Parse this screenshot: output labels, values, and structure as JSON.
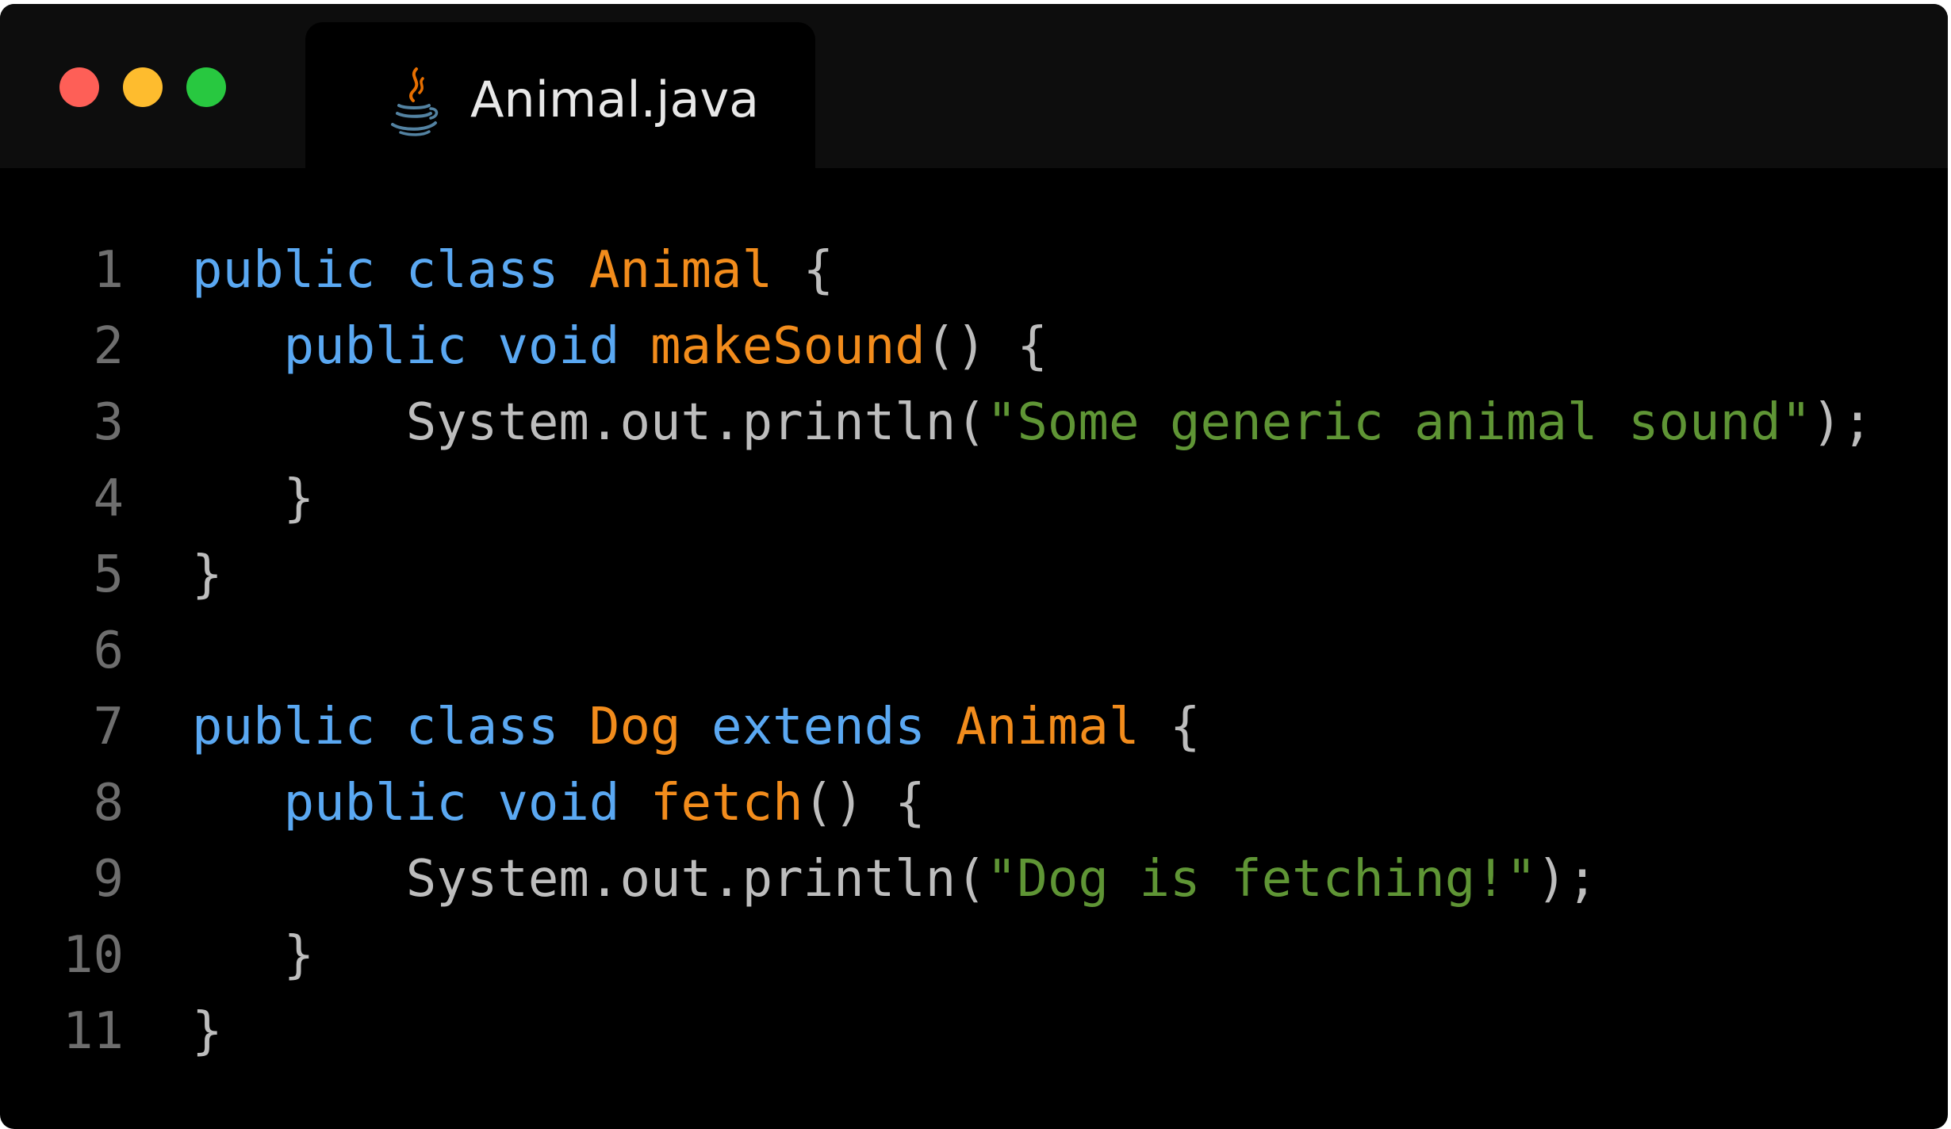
{
  "window": {
    "traffic_lights": [
      "close",
      "minimize",
      "zoom"
    ],
    "colors": {
      "close": "#fe5f57",
      "minimize": "#febc2e",
      "zoom": "#28c840",
      "keyword": "#5aa8f2",
      "type": "#f28c1c",
      "string": "#5f9535",
      "plain": "#bdbdbd",
      "line_number": "#6e6e6e"
    }
  },
  "tab": {
    "icon": "java-icon",
    "title": "Animal.java"
  },
  "code": {
    "language": "java",
    "lines": [
      {
        "number": "1",
        "tokens": [
          {
            "t": "keyword",
            "v": "public"
          },
          {
            "t": "plain",
            "v": " "
          },
          {
            "t": "keyword",
            "v": "class"
          },
          {
            "t": "plain",
            "v": " "
          },
          {
            "t": "type",
            "v": "Animal"
          },
          {
            "t": "plain",
            "v": " {"
          }
        ]
      },
      {
        "number": "2",
        "tokens": [
          {
            "t": "plain",
            "v": "   "
          },
          {
            "t": "keyword",
            "v": "public"
          },
          {
            "t": "plain",
            "v": " "
          },
          {
            "t": "keyword",
            "v": "void"
          },
          {
            "t": "plain",
            "v": " "
          },
          {
            "t": "method",
            "v": "makeSound"
          },
          {
            "t": "plain",
            "v": "() {"
          }
        ]
      },
      {
        "number": "3",
        "tokens": [
          {
            "t": "plain",
            "v": "       System.out.println("
          },
          {
            "t": "string",
            "v": "\"Some generic animal sound\""
          },
          {
            "t": "plain",
            "v": ");"
          }
        ]
      },
      {
        "number": "4",
        "tokens": [
          {
            "t": "plain",
            "v": "   }"
          }
        ]
      },
      {
        "number": "5",
        "tokens": [
          {
            "t": "plain",
            "v": "}"
          }
        ]
      },
      {
        "number": "6",
        "tokens": []
      },
      {
        "number": "7",
        "tokens": [
          {
            "t": "keyword",
            "v": "public"
          },
          {
            "t": "plain",
            "v": " "
          },
          {
            "t": "keyword",
            "v": "class"
          },
          {
            "t": "plain",
            "v": " "
          },
          {
            "t": "type",
            "v": "Dog"
          },
          {
            "t": "plain",
            "v": " "
          },
          {
            "t": "keyword",
            "v": "extends"
          },
          {
            "t": "plain",
            "v": " "
          },
          {
            "t": "type",
            "v": "Animal"
          },
          {
            "t": "plain",
            "v": " {"
          }
        ]
      },
      {
        "number": "8",
        "tokens": [
          {
            "t": "plain",
            "v": "   "
          },
          {
            "t": "keyword",
            "v": "public"
          },
          {
            "t": "plain",
            "v": " "
          },
          {
            "t": "keyword",
            "v": "void"
          },
          {
            "t": "plain",
            "v": " "
          },
          {
            "t": "method",
            "v": "fetch"
          },
          {
            "t": "plain",
            "v": "() {"
          }
        ]
      },
      {
        "number": "9",
        "tokens": [
          {
            "t": "plain",
            "v": "       System.out.println("
          },
          {
            "t": "string",
            "v": "\"Dog is fetching!\""
          },
          {
            "t": "plain",
            "v": ");"
          }
        ]
      },
      {
        "number": "10",
        "tokens": [
          {
            "t": "plain",
            "v": "   }"
          }
        ]
      },
      {
        "number": "11",
        "tokens": [
          {
            "t": "plain",
            "v": "}"
          }
        ]
      }
    ]
  }
}
